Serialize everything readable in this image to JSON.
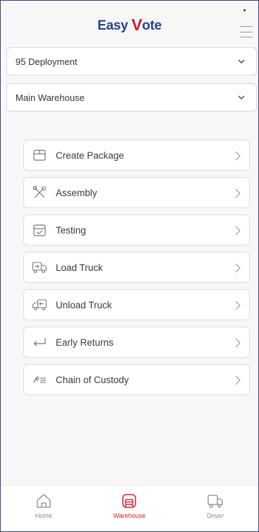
{
  "header": {
    "logo_part1": "Easy",
    "logo_part2": "V",
    "logo_part3": "ote"
  },
  "selectors": [
    {
      "value": "95 Deployment"
    },
    {
      "value": "Main Warehouse"
    }
  ],
  "menu": [
    {
      "label": "Create Package",
      "icon": "package-icon"
    },
    {
      "label": "Assembly",
      "icon": "tools-icon"
    },
    {
      "label": "Testing",
      "icon": "testing-icon"
    },
    {
      "label": "Load Truck",
      "icon": "load-truck-icon"
    },
    {
      "label": "Unload Truck",
      "icon": "unload-truck-icon"
    },
    {
      "label": "Early Returns",
      "icon": "return-arrow-icon"
    },
    {
      "label": "Chain of Custody",
      "icon": "custody-icon"
    }
  ],
  "tabs": [
    {
      "label": "Home",
      "icon": "home-icon"
    },
    {
      "label": "Warehouse",
      "icon": "warehouse-icon",
      "active": true
    },
    {
      "label": "Driver",
      "icon": "truck-icon"
    }
  ],
  "colors": {
    "brand_blue": "#2a3f8f",
    "brand_red": "#d31b2b",
    "active_tab": "#d0202f"
  }
}
